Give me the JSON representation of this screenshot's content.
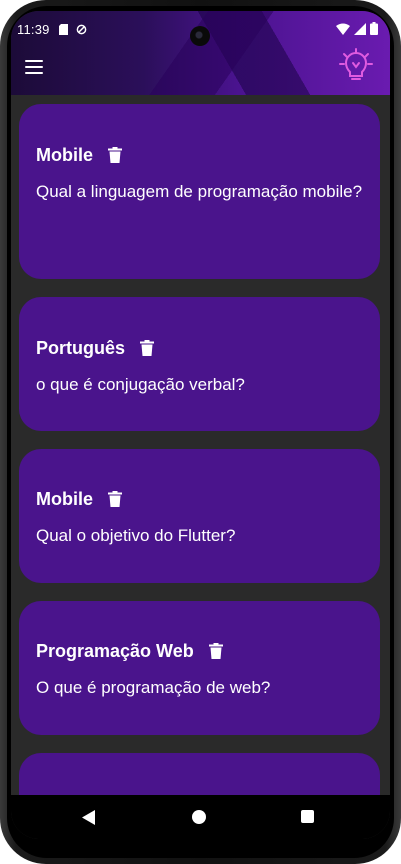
{
  "status_bar": {
    "time": "11:39"
  },
  "app_bar": {
    "menu_icon": "hamburger-menu-icon",
    "logo_icon": "lightbulb-logo-icon",
    "gradient_colors": [
      "#1c0b38",
      "#4a138f",
      "#6a1bb0"
    ]
  },
  "cards": [
    {
      "title": "Mobile",
      "question": "Qual a linguagem de programação mobile?",
      "delete_icon": "trash-icon"
    },
    {
      "title": "Português",
      "question": "o que é conjugação verbal?",
      "delete_icon": "trash-icon"
    },
    {
      "title": "Mobile",
      "question": "Qual o objetivo do Flutter?",
      "delete_icon": "trash-icon"
    },
    {
      "title": "Programação Web",
      "question": "O que é programação de web?",
      "delete_icon": "trash-icon"
    },
    {
      "title": "",
      "question": "",
      "delete_icon": ""
    }
  ],
  "colors": {
    "card_background": "#4a148c",
    "list_background": "#2a2a2a",
    "text": "#ffffff",
    "logo_accent": "#e05be0"
  },
  "nav_bar": {
    "back_icon": "back-triangle-icon",
    "home_icon": "home-circle-icon",
    "recents_icon": "recents-square-icon"
  }
}
